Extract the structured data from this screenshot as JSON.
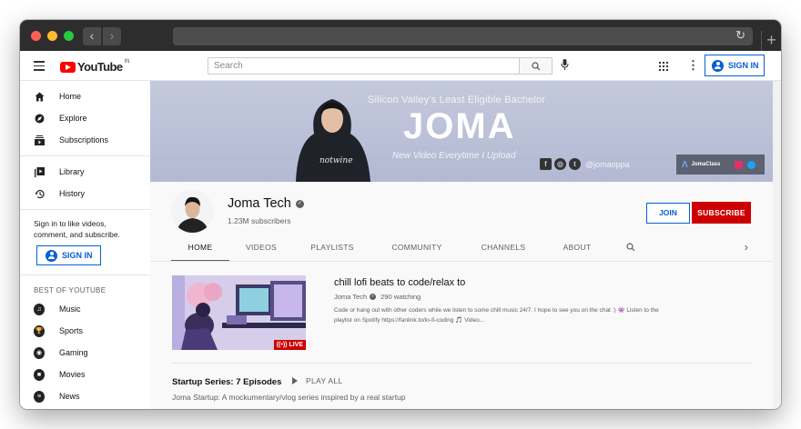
{
  "browser": {
    "reload_icon": "reload-icon",
    "new_tab": "+",
    "back": "‹",
    "forward": "›"
  },
  "topbar": {
    "logo_text": "YouTube",
    "logo_suffix": "IN",
    "search_placeholder": "Search",
    "signin_label": "SIGN IN"
  },
  "sidebar": {
    "items": [
      {
        "label": "Home",
        "icon": "home-icon"
      },
      {
        "label": "Explore",
        "icon": "compass-icon"
      },
      {
        "label": "Subscriptions",
        "icon": "subscriptions-icon"
      },
      {
        "label": "Library",
        "icon": "library-icon"
      },
      {
        "label": "History",
        "icon": "history-icon"
      }
    ],
    "signin_prompt": "Sign in to like videos, comment, and subscribe.",
    "signin_label": "SIGN IN",
    "best_heading": "BEST OF YOUTUBE",
    "categories": [
      {
        "label": "Music",
        "icon": "music-icon"
      },
      {
        "label": "Sports",
        "icon": "sports-icon"
      },
      {
        "label": "Gaming",
        "icon": "gaming-icon"
      },
      {
        "label": "Movies",
        "icon": "movies-icon"
      },
      {
        "label": "News",
        "icon": "news-icon"
      }
    ]
  },
  "banner": {
    "tagline": "Silicon Valley's Least Eligible Bachelor",
    "headline": "JOMA",
    "subline": "New Video Everytime I Upload",
    "handle": "@jomaoppa",
    "shirt_text": "notwine",
    "link_label": "JomaClass"
  },
  "channel": {
    "name": "Joma Tech",
    "subscribers": "1.23M subscribers",
    "join_label": "JOIN",
    "subscribe_label": "SUBSCRIBE"
  },
  "tabs": [
    "HOME",
    "VIDEOS",
    "PLAYLISTS",
    "COMMUNITY",
    "CHANNELS",
    "ABOUT"
  ],
  "featured": {
    "title": "chill lofi beats to code/relax to",
    "channel": "Joma Tech",
    "watching": "290 watching",
    "live_label": "LIVE",
    "description": "Code or hang out with other coders while we listen to some chill music 24/7. I hope to see you on the chat :) 👾 Listen to the playlist on Spotify https://fanlink.to/lo-fi-coding 🎵 Video..."
  },
  "shelf": {
    "title": "Startup Series: 7 Episodes",
    "play_all": "PLAY ALL",
    "description": "Joma Startup: A mockumentary/vlog series inspired by a real startup"
  },
  "colors": {
    "brand_red": "#ff0000",
    "subscribe_red": "#cc0000",
    "link_blue": "#065fd4",
    "banner": "#bfc4da"
  }
}
